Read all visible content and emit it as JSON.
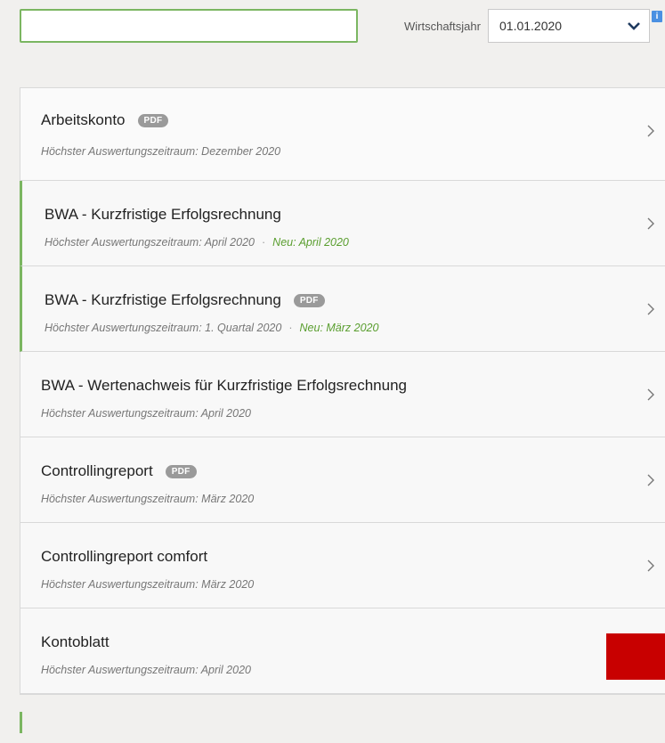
{
  "search": {
    "value": "",
    "placeholder": ""
  },
  "fiscal_year": {
    "label": "Wirtschaftsjahr",
    "selected": "01.01.2020"
  },
  "info_icon": {
    "glyph": "i"
  },
  "reports": [
    {
      "title": "Arbeitskonto",
      "pdf": "PDF",
      "period": "Höchster Auswertungszeitraum: Dezember 2020",
      "new": ""
    },
    {
      "title": "BWA - Kurzfristige Erfolgsrechnung",
      "pdf": "",
      "period": "Höchster Auswertungszeitraum: April 2020",
      "new": "Neu: April 2020"
    },
    {
      "title": "BWA - Kurzfristige Erfolgsrechnung",
      "pdf": "PDF",
      "period": "Höchster Auswertungszeitraum: 1. Quartal 2020",
      "new": "Neu: März 2020"
    },
    {
      "title": "BWA - Wertenachweis für Kurzfristige Erfolgsrechnung",
      "pdf": "",
      "period": "Höchster Auswertungszeitraum: April 2020",
      "new": ""
    },
    {
      "title": "Controllingreport",
      "pdf": "PDF",
      "period": "Höchster Auswertungszeitraum: März 2020",
      "new": ""
    },
    {
      "title": "Controllingreport comfort",
      "pdf": "",
      "period": "Höchster Auswertungszeitraum: März 2020",
      "new": ""
    },
    {
      "title": "Kontoblatt",
      "pdf": "",
      "period": "Höchster Auswertungszeitraum: April 2020",
      "new": ""
    }
  ],
  "colors": {
    "accent_green": "#7bb661",
    "new_text": "#5a9e2f",
    "info_blue": "#4a90e2",
    "red_block": "#c80000"
  }
}
